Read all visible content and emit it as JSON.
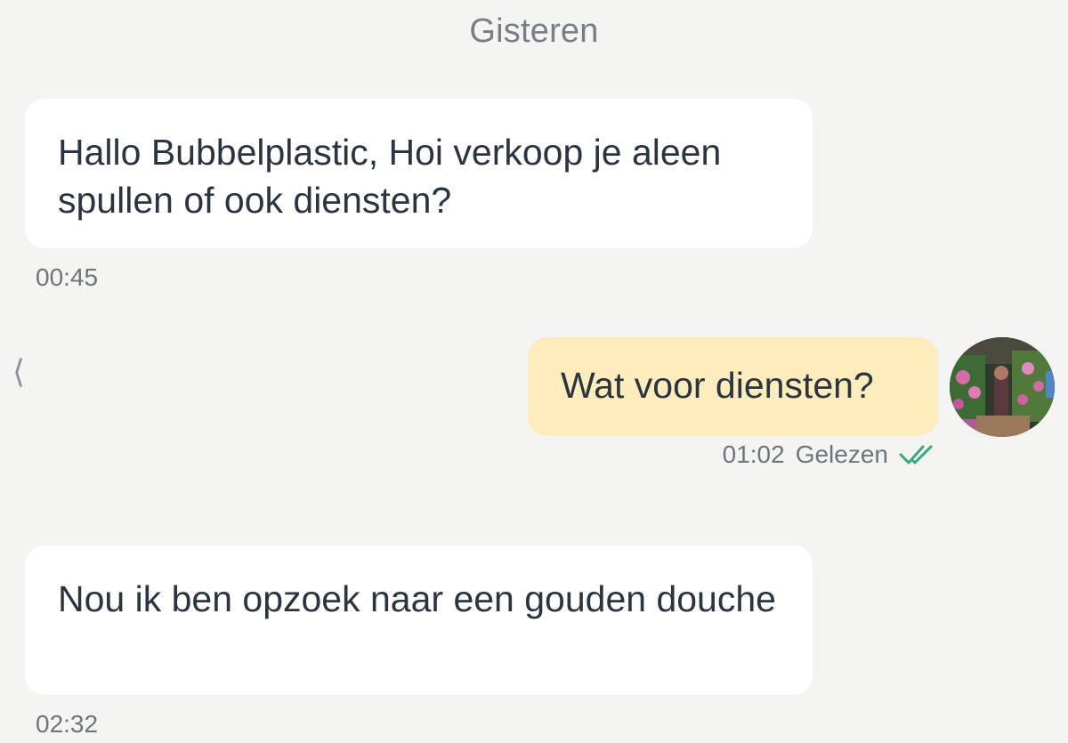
{
  "date_separator": "Gisteren",
  "messages": [
    {
      "direction": "incoming",
      "text": "Hallo Bubbelplastic,  Hoi verkoop je aleen spullen of ook diensten?",
      "time": "00:45"
    },
    {
      "direction": "outgoing",
      "text": "Wat voor diensten?",
      "time": "01:02",
      "status": "Gelezen",
      "status_icon": "double-check-icon"
    },
    {
      "direction": "incoming",
      "text": "Nou ik ben opzoek naar een gouden douche",
      "time": "02:32"
    }
  ],
  "back_icon": "chevron-left-icon",
  "colors": {
    "background": "#f4f4f2",
    "incoming_bubble": "#ffffff",
    "outgoing_bubble": "#fdedbd",
    "read_check": "#3aa883",
    "text": "#2b3440",
    "meta_text": "#6f757b"
  }
}
